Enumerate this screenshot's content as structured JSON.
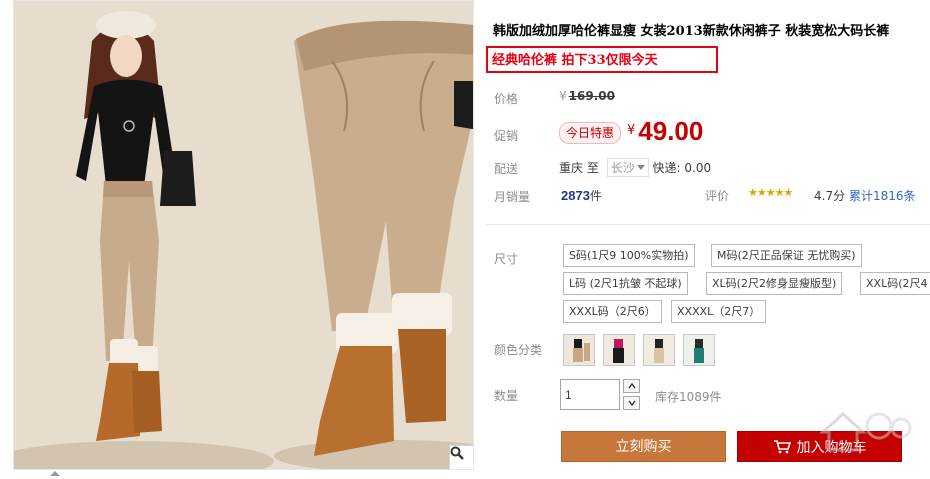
{
  "product": {
    "title": "韩版加绒加厚哈伦裤显瘦 女装2013新款休闲裤子 秋装宽松大码长裤",
    "promo": "经典哈伦裤 拍下33仅限今天"
  },
  "price": {
    "label": "价格",
    "currency": "¥",
    "original": "169.00",
    "promo_label": "促销",
    "badge": "今日特惠",
    "current": "49.00"
  },
  "shipping": {
    "label": "配送",
    "from": "重庆",
    "to_word": "至",
    "to_city": "长沙",
    "fee": "快递: 0.00"
  },
  "sales": {
    "label": "月销量",
    "count": "2873",
    "unit": "件",
    "rating_label": "评价",
    "stars": "★★★★★",
    "score": "4.7分",
    "reviews": "累计1816条"
  },
  "sizes": {
    "label": "尺寸",
    "options": [
      "S码(1尺9 100%实物拍)",
      "M码(2尺正品保证 无忧购买)",
      "L码 (2尺1抗皱 不起球)",
      "XL码(2尺2修身显瘦版型)",
      "XXL码(2尺4",
      "XXXL码（2尺6）",
      "XXXXL（2尺7）"
    ]
  },
  "colors": {
    "label": "颜色分类",
    "swatches": [
      "khaki",
      "black",
      "beige",
      "teal"
    ]
  },
  "quantity": {
    "label": "数量",
    "value": "1",
    "stock": "库存1089件"
  },
  "actions": {
    "buy": "立刻购买",
    "cart": "加入购物车"
  },
  "colors_theme": {
    "price_red": "#c40000",
    "promo_red": "#e60012",
    "buy_brown": "#c8773b",
    "link_blue": "#3366cc",
    "star_gold": "#e5a100"
  },
  "icons": [
    "search-icon",
    "cart-icon",
    "chevron-up-icon",
    "chevron-down-icon",
    "dropdown-caret-icon"
  ]
}
